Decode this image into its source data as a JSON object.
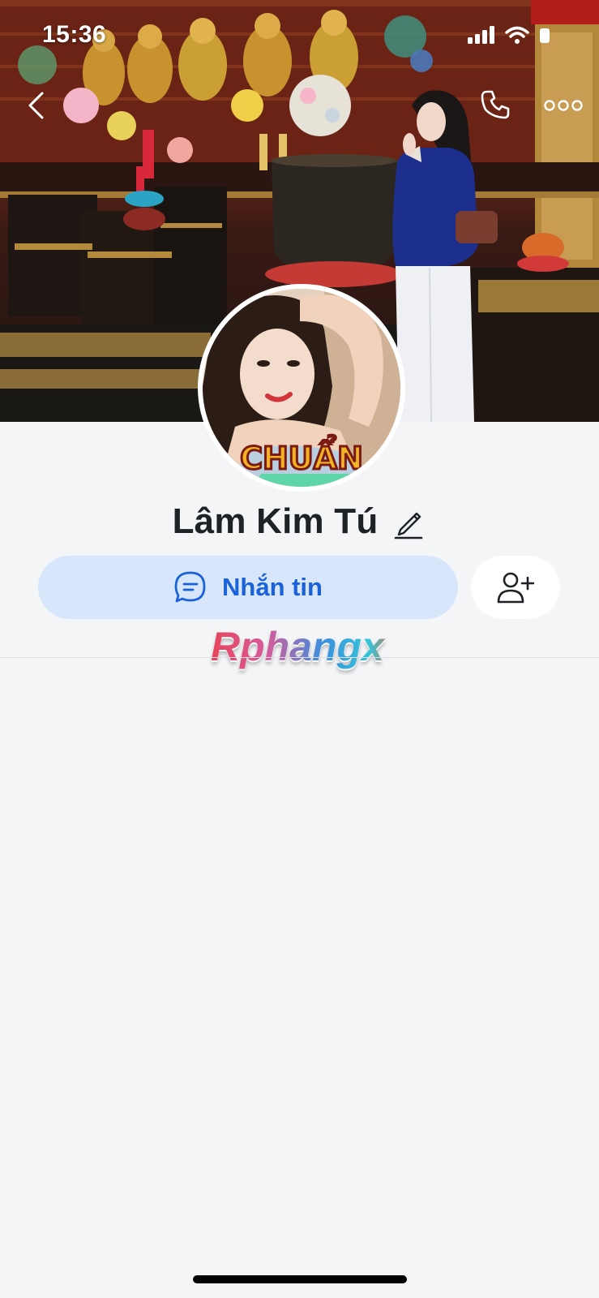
{
  "status_bar": {
    "time": "15:36",
    "icons": [
      "signal-icon",
      "wifi-icon",
      "battery-icon"
    ]
  },
  "nav": {
    "back_icon": "chevron-left-icon",
    "call_icon": "phone-icon",
    "more_icon": "more-horizontal-icon"
  },
  "profile": {
    "name": "Lâm Kim Tú",
    "avatar_caption": "CHUẨN",
    "edit_icon": "pencil-icon"
  },
  "actions": {
    "message_label": "Nhắn tin",
    "message_icon": "chat-bubble-icon",
    "add_friend_icon": "add-user-icon"
  },
  "watermark": "Rphangx",
  "colors": {
    "background": "#f4f5f7",
    "message_button_bg": "#d8e6fc",
    "message_button_text": "#1a62d8",
    "name_text": "#1e2125"
  }
}
